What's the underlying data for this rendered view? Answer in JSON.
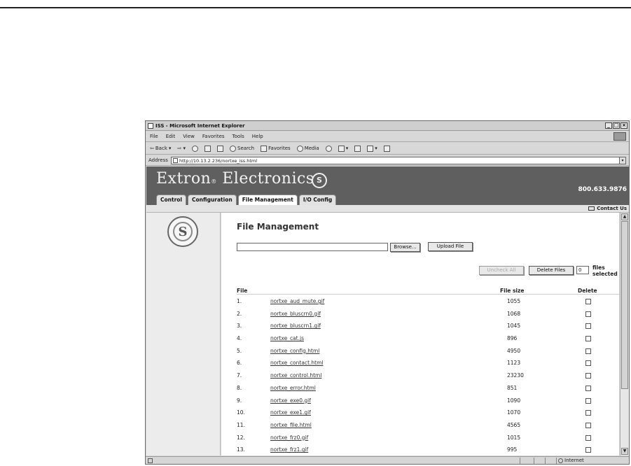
{
  "window": {
    "title": "ISS - Microsoft Internet Explorer",
    "controls": [
      "_",
      "□",
      "×"
    ]
  },
  "menu": [
    "File",
    "Edit",
    "View",
    "Favorites",
    "Tools",
    "Help"
  ],
  "toolbar": {
    "back": "Back",
    "search": "Search",
    "favorites": "Favorites",
    "media": "Media"
  },
  "address": {
    "label": "Address",
    "url": "http://10.13.2.236/nortxe_iss.html"
  },
  "banner": {
    "brand": "Extron",
    "brand_reg": "®",
    "brand_rest": " Electronics",
    "phone": "800.633.9876"
  },
  "tabs": [
    "Control",
    "Configuration",
    "File Management",
    "I/O Config"
  ],
  "contact_label": "Contact Us",
  "page": {
    "title": "File Management",
    "browse_label": "Browse...",
    "upload_label": "Upload File",
    "uncheck_label": "Uncheck All",
    "delete_label": "Delete Files",
    "selected_count": "0",
    "files_label": "files",
    "selected_label": "selected"
  },
  "table": {
    "headers": {
      "file": "File",
      "size": "File size",
      "delete": "Delete"
    },
    "rows": [
      {
        "num": "1.",
        "name": "nortxe_aud_mute.gif",
        "size": "1055"
      },
      {
        "num": "2.",
        "name": "nortxe_bluscrn0.gif",
        "size": "1068"
      },
      {
        "num": "3.",
        "name": "nortxe_bluscrn1.gif",
        "size": "1045"
      },
      {
        "num": "4.",
        "name": "nortxe_cat.js",
        "size": "896"
      },
      {
        "num": "5.",
        "name": "nortxe_config.html",
        "size": "4950"
      },
      {
        "num": "6.",
        "name": "nortxe_contact.html",
        "size": "1123"
      },
      {
        "num": "7.",
        "name": "nortxe_control.html",
        "size": "23230"
      },
      {
        "num": "8.",
        "name": "nortxe_error.html",
        "size": "851"
      },
      {
        "num": "9.",
        "name": "nortxe_exe0.gif",
        "size": "1090"
      },
      {
        "num": "10.",
        "name": "nortxe_exe1.gif",
        "size": "1070"
      },
      {
        "num": "11.",
        "name": "nortxe_file.html",
        "size": "4565"
      },
      {
        "num": "12.",
        "name": "nortxe_frz0.gif",
        "size": "1015"
      },
      {
        "num": "13.",
        "name": "nortxe_frz1.gif",
        "size": "995"
      }
    ]
  },
  "status": {
    "zone": "Internet"
  }
}
